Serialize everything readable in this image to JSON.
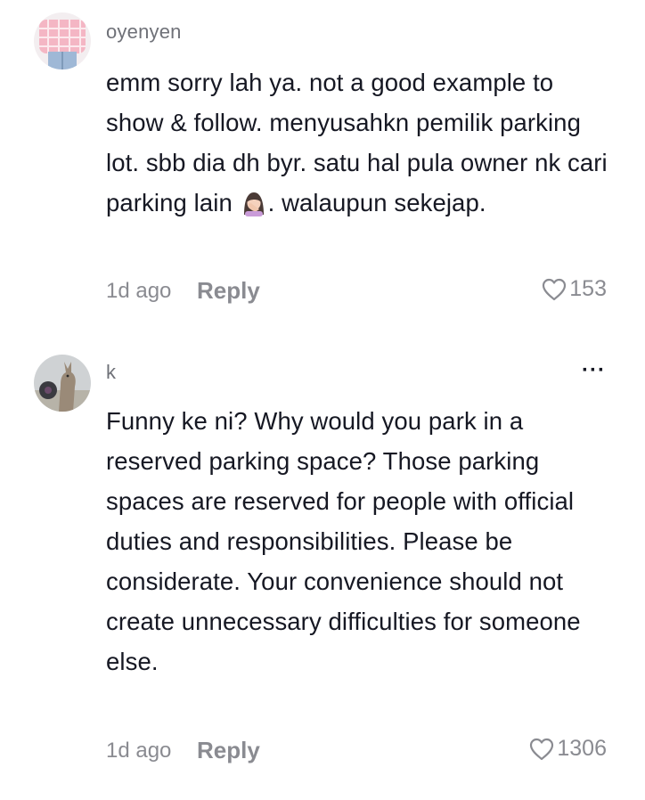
{
  "comments": [
    {
      "username": "oyenyen",
      "text_before_emoji": "emm sorry lah ya. not a good example to show & follow. menyusahkn pemilik parking lot. sbb dia dh byr. satu hal pula owner nk cari parking lain ",
      "emoji": "woman-facepalming-emoji",
      "text_after_emoji": ". walaupun sekejap.",
      "time": "1d ago",
      "reply_label": "Reply",
      "likes": "153",
      "colors": {
        "avatar_shirt": "#f4b6c4",
        "avatar_pants": "#9fb8d6"
      }
    },
    {
      "username": "k",
      "text": "Funny ke ni? Why would you park in a reserved parking space? Those parking spaces are reserved for people with official duties and responsibilities. Please be considerate. Your convenience should not create unnecessary difficulties for someone else.",
      "time": "1d ago",
      "reply_label": "Reply",
      "likes": "1306",
      "more_label": "···",
      "colors": {
        "avatar_bg": "#cfd2d4",
        "avatar_animal": "#9a8a78"
      }
    }
  ],
  "icons": {
    "like": "heart-outline-icon",
    "more": "more-options-icon"
  },
  "colors": {
    "primary_text": "#161823",
    "secondary_text": "#8a8b91",
    "background": "#ffffff"
  }
}
